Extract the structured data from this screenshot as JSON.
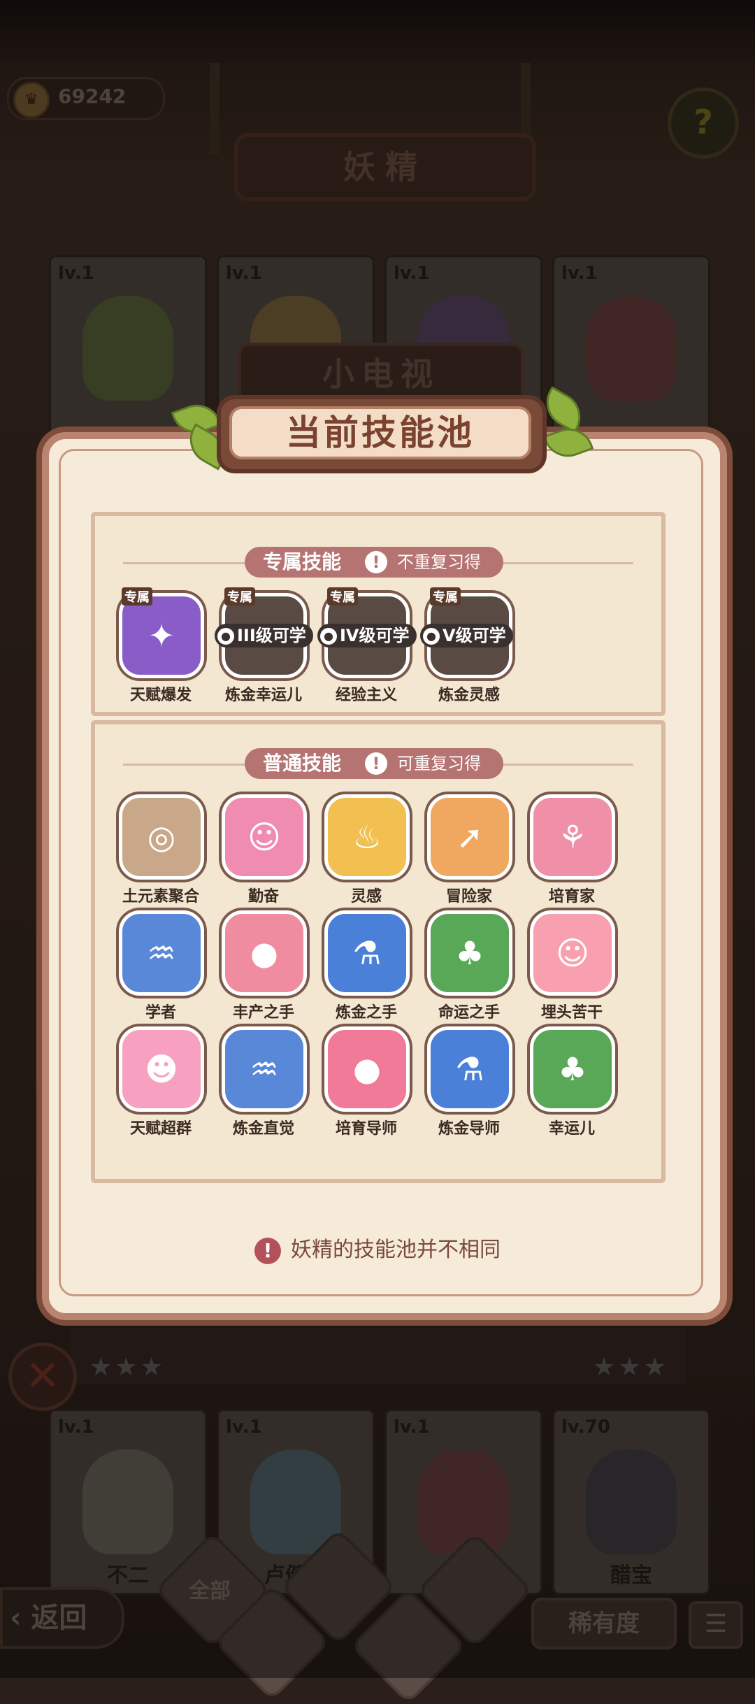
{
  "top": {
    "coins": "69242",
    "help_icon": "question-icon",
    "page_title": "妖精"
  },
  "bg_cards_top": [
    {
      "level": "lv.1",
      "color": "#6a8c3a"
    },
    {
      "level": "lv.1",
      "color": "#b08a3a"
    },
    {
      "level": "lv.1",
      "color": "#6a4a8a"
    },
    {
      "level": "lv.1",
      "color": "#8a3a3a"
    }
  ],
  "tv_sign": "小电视",
  "modal": {
    "title": "当前技能池",
    "exclusive": {
      "header": "专属技能",
      "note": "不重复习得",
      "skills": [
        {
          "tag": "专属",
          "label": "天赋爆发",
          "lock": "",
          "color": "#8a5cc8",
          "icon": "figure-burst-icon",
          "sym": "✦"
        },
        {
          "tag": "专属",
          "label": "炼金幸运儿",
          "lock": "III级可学",
          "color": "#5a5050",
          "icon": "lock-icon",
          "sym": ""
        },
        {
          "tag": "专属",
          "label": "经验主义",
          "lock": "IV级可学",
          "color": "#5a5050",
          "icon": "lock-icon",
          "sym": ""
        },
        {
          "tag": "专属",
          "label": "炼金灵感",
          "lock": "V级可学",
          "color": "#5a5050",
          "icon": "lock-icon",
          "sym": ""
        }
      ]
    },
    "normal": {
      "header": "普通技能",
      "note": "可重复习得",
      "skills": [
        {
          "label": "土元素聚合",
          "color": "#c9a88a",
          "icon": "swirl-icon",
          "sym": "◎"
        },
        {
          "label": "勤奋",
          "color": "#f08cb0",
          "icon": "smile-face-icon",
          "sym": "☺"
        },
        {
          "label": "灵感",
          "color": "#f2c050",
          "icon": "pot-icon",
          "sym": "♨"
        },
        {
          "label": "冒险家",
          "color": "#f0a860",
          "icon": "map-arrow-icon",
          "sym": "➚"
        },
        {
          "label": "培育家",
          "color": "#f090a8",
          "icon": "watering-can-icon",
          "sym": "⚘"
        },
        {
          "label": "学者",
          "color": "#5a88d8",
          "icon": "shell-icon",
          "sym": "♒"
        },
        {
          "label": "丰产之手",
          "color": "#f08ca0",
          "icon": "tomato-icon",
          "sym": "●"
        },
        {
          "label": "炼金之手",
          "color": "#4a80d8",
          "icon": "cauldron-icon",
          "sym": "⚗"
        },
        {
          "label": "命运之手",
          "color": "#58a858",
          "icon": "clover-icon",
          "sym": "♣"
        },
        {
          "label": "埋头苦干",
          "color": "#f8a0b0",
          "icon": "smile-face-icon",
          "sym": "☺"
        },
        {
          "label": "天赋超群",
          "color": "#f8a0c0",
          "icon": "surprised-face-icon",
          "sym": "☻"
        },
        {
          "label": "炼金直觉",
          "color": "#5a88d8",
          "icon": "shell-icon",
          "sym": "♒"
        },
        {
          "label": "培育导师",
          "color": "#f07a98",
          "icon": "tomato-icon",
          "sym": "●"
        },
        {
          "label": "炼金导师",
          "color": "#4a80d8",
          "icon": "cauldron-icon",
          "sym": "⚗"
        },
        {
          "label": "幸运儿",
          "color": "#58a858",
          "icon": "clover-icon",
          "sym": "♣"
        }
      ]
    },
    "footer_note": "妖精的技能池并不相同"
  },
  "bg_cards_bottom": [
    {
      "level": "lv.1",
      "name": "不二",
      "color": "#8a8a7a"
    },
    {
      "level": "lv.1",
      "name": "卢健瞳",
      "color": "#5a8a9a"
    },
    {
      "level": "lv.1",
      "name": "",
      "color": "#8a3a3a"
    },
    {
      "level": "lv.70",
      "name": "醋宝",
      "color": "#3a3a4a"
    }
  ],
  "bottom_bar": {
    "back": "返回",
    "filter_all": "全部",
    "rarity": "稀有度",
    "list_icon": "list-icon"
  },
  "stars": "★★★"
}
